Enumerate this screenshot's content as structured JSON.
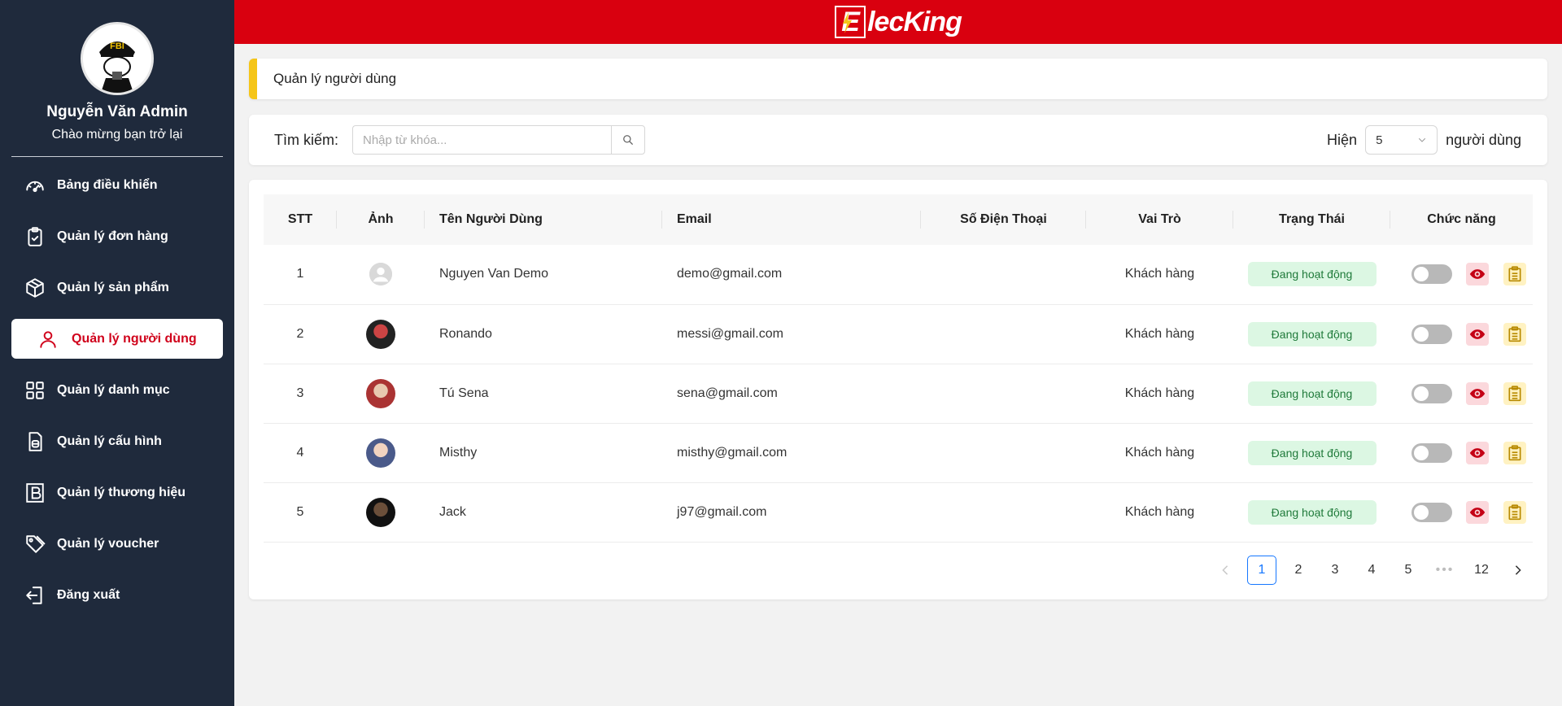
{
  "brand": {
    "logo_text": "lecKing",
    "logo_letter": "E",
    "header_color": "#d9000f"
  },
  "profile": {
    "name": "Nguyễn Văn Admin",
    "welcome": "Chào mừng bạn trở lại",
    "avatar_badge": "FBI"
  },
  "sidebar": {
    "items": [
      {
        "label": "Bảng điều khiển",
        "icon": "dashboard-icon"
      },
      {
        "label": "Quản lý đơn hàng",
        "icon": "clipboard-check-icon"
      },
      {
        "label": "Quản lý sản phẩm",
        "icon": "box-icon"
      },
      {
        "label": "Quản lý người dùng",
        "icon": "user-icon",
        "active": true
      },
      {
        "label": "Quản lý danh mục",
        "icon": "grid-icon"
      },
      {
        "label": "Quản lý cấu hình",
        "icon": "file-config-icon"
      },
      {
        "label": "Quản lý thương hiệu",
        "icon": "brand-b-icon"
      },
      {
        "label": "Quản lý voucher",
        "icon": "tag-icon"
      },
      {
        "label": "Đăng xuất",
        "icon": "logout-icon"
      }
    ]
  },
  "page": {
    "title": "Quản lý người dùng"
  },
  "filter": {
    "search_label": "Tìm kiếm:",
    "search_placeholder": "Nhập từ khóa...",
    "show_label": "Hiện",
    "show_value": "5",
    "show_unit": "người dùng"
  },
  "table": {
    "headers": [
      "STT",
      "Ảnh",
      "Tên Người Dùng",
      "Email",
      "Số Điện Thoại",
      "Vai Trò",
      "Trạng Thái",
      "Chức năng"
    ],
    "rows": [
      {
        "stt": "1",
        "name": "Nguyen Van Demo",
        "email": "demo@gmail.com",
        "phone": "",
        "role": "Khách hàng",
        "status": "Đang hoạt động",
        "avatar": "default"
      },
      {
        "stt": "2",
        "name": "Ronando",
        "email": "messi@gmail.com",
        "phone": "",
        "role": "Khách hàng",
        "status": "Đang hoạt động",
        "avatar": "photo"
      },
      {
        "stt": "3",
        "name": "Tú Sena",
        "email": "sena@gmail.com",
        "phone": "",
        "role": "Khách hàng",
        "status": "Đang hoạt động",
        "avatar": "photo"
      },
      {
        "stt": "4",
        "name": "Misthy",
        "email": "misthy@gmail.com",
        "phone": "",
        "role": "Khách hàng",
        "status": "Đang hoạt động",
        "avatar": "photo"
      },
      {
        "stt": "5",
        "name": "Jack",
        "email": "j97@gmail.com",
        "phone": "",
        "role": "Khách hàng",
        "status": "Đang hoạt động",
        "avatar": "photo"
      }
    ]
  },
  "pagination": {
    "pages": [
      "1",
      "2",
      "3",
      "4",
      "5"
    ],
    "ellipsis": "•••",
    "last": "12",
    "current": "1"
  }
}
